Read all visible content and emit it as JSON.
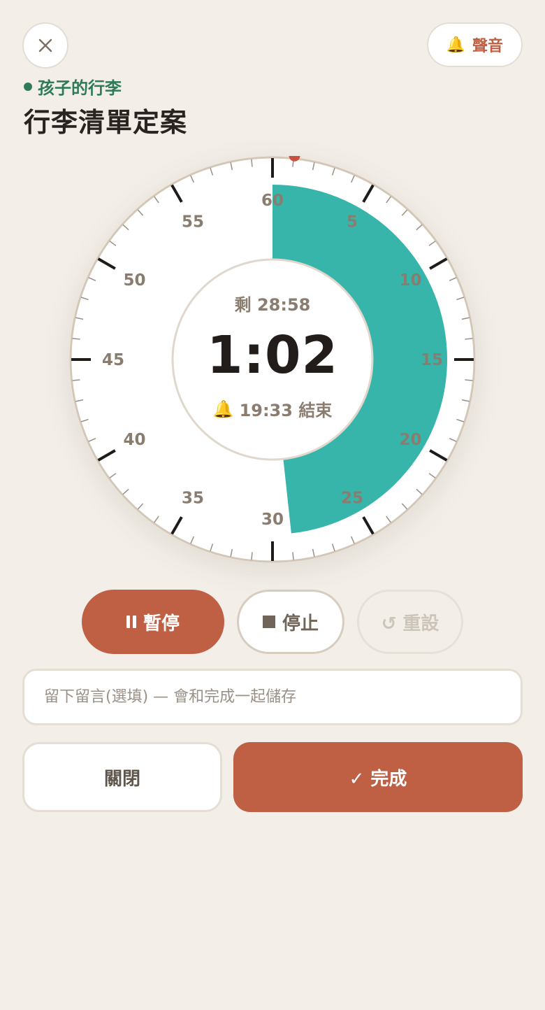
{
  "header": {
    "close_icon": "close-icon",
    "sound_icon": "bell-icon",
    "sound_label": "聲音",
    "subtitle": "孩子的行李",
    "title": "行李清單定案"
  },
  "timer": {
    "remaining_label": "剩 28:58",
    "elapsed": "1:02",
    "end_icon": "bell-icon",
    "end_time_label": "19:33 結束",
    "total_minutes": 30,
    "elapsed_minutes": 1.03,
    "dial_numbers": [
      "60",
      "5",
      "10",
      "15",
      "20",
      "25",
      "30",
      "35",
      "40",
      "45",
      "50",
      "55"
    ],
    "accent_color": "#37b5aa",
    "needle_color": "#c9503e"
  },
  "controls": {
    "pause_label": "暫停",
    "stop_label": "停止",
    "reset_label": "↺ 重設"
  },
  "note": {
    "placeholder": "留下留言(選填) — 會和完成一起儲存"
  },
  "footer": {
    "close_label": "關閉",
    "done_label": "✓ 完成"
  },
  "colors": {
    "background": "#f3eee8",
    "primary": "#bf6044",
    "subtitle": "#2f7b57"
  }
}
